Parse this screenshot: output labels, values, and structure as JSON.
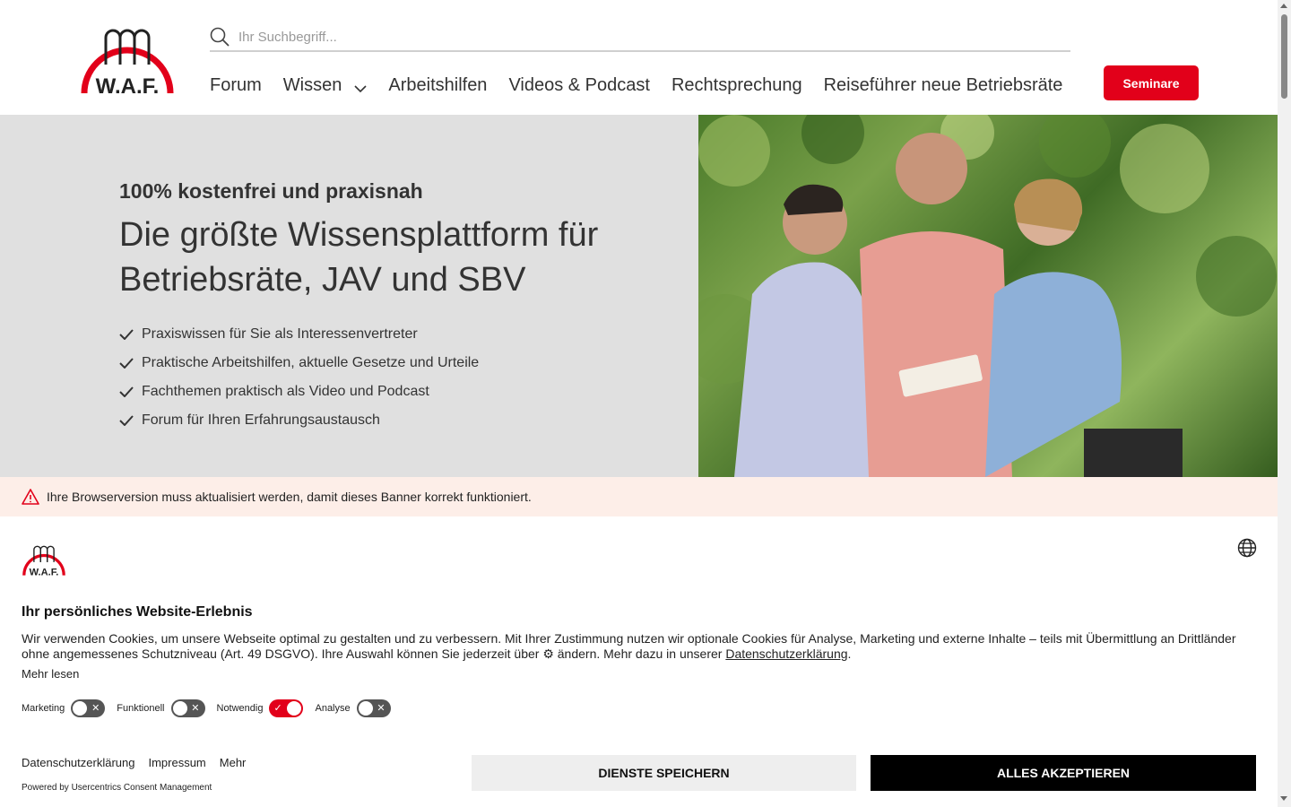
{
  "header": {
    "logo_text": "W.A.F.",
    "search_placeholder": "Ihr Suchbegriff...",
    "nav": [
      "Forum",
      "Wissen",
      "Arbeitshilfen",
      "Videos & Podcast",
      "Rechtsprechung",
      "Reiseführer neue Betriebsräte"
    ],
    "seminare_label": "Seminare",
    "accent_color": "#e2001a"
  },
  "hero": {
    "kicker": "100% kostenfrei und praxisnah",
    "headline": "Die größte Wissensplattform für Betriebsräte, JAV und SBV",
    "bullets": [
      "Praxiswissen für Sie als Interessenvertreter",
      "Praktische Arbeitshilfen, aktuelle Gesetze und Urteile",
      "Fachthemen praktisch als Video und Podcast",
      "Forum für Ihren Erfahrungsaustausch"
    ]
  },
  "warning": {
    "text": "Ihre Browserversion muss aktualisiert werden, damit dieses Banner korrekt funktioniert."
  },
  "consent": {
    "title": "Ihr persönliches Website-Erlebnis",
    "body_pre": "Wir verwenden Cookies, um unsere Webseite optimal zu gestalten und zu verbessern. Mit Ihrer Zustimmung nutzen wir optionale Cookies für Analyse, Marketing und externe Inhalte – teils mit Übermittlung an Drittländer ohne angemessenes Schutzniveau (Art. 49 DSGVO). Ihre Auswahl können Sie jederzeit über ⚙ ändern. Mehr dazu in unserer ",
    "body_link": "Datenschutzerklärung",
    "body_post": ".",
    "more_label": "Mehr lesen",
    "toggles": [
      {
        "label": "Marketing",
        "on": false
      },
      {
        "label": "Funktionell",
        "on": false
      },
      {
        "label": "Notwendig",
        "on": true
      },
      {
        "label": "Analyse",
        "on": false
      }
    ],
    "footer_links": [
      "Datenschutzerklärung",
      "Impressum",
      "Mehr"
    ],
    "powered_by": "Powered by Usercentrics Consent Management",
    "save_label": "DIENSTE SPEICHERN",
    "accept_label": "ALLES AKZEPTIEREN"
  }
}
